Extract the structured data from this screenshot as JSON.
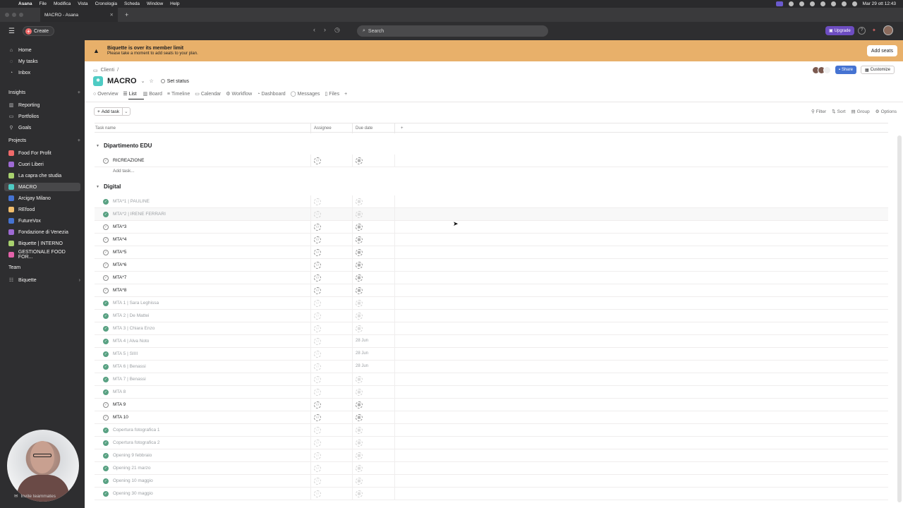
{
  "menubar": {
    "app": "Asana",
    "items": [
      "File",
      "Modifica",
      "Vista",
      "Cronologia",
      "Scheda",
      "Window",
      "Help"
    ],
    "clock": "Mar 29 ott  12:43"
  },
  "browser": {
    "tab_title": "MACRO - Asana"
  },
  "topbar": {
    "create_label": "Create",
    "search_placeholder": "Search",
    "upgrade_label": "Upgrade",
    "help_label": "?"
  },
  "sidebar": {
    "nav": [
      {
        "label": "Home",
        "icon": "home-icon"
      },
      {
        "label": "My tasks",
        "icon": "check-circle-icon"
      },
      {
        "label": "Inbox",
        "icon": "bell-icon"
      }
    ],
    "insights_header": "Insights",
    "insights": [
      {
        "label": "Reporting",
        "icon": "chart-icon"
      },
      {
        "label": "Portfolios",
        "icon": "folder-icon"
      },
      {
        "label": "Goals",
        "icon": "person-icon"
      }
    ],
    "projects_header": "Projects",
    "projects": [
      {
        "label": "Food For Profit",
        "color": "#f06a6a"
      },
      {
        "label": "Cuori Liberi",
        "color": "#9e6ad4"
      },
      {
        "label": "La capra che studia",
        "color": "#a8d16e"
      },
      {
        "label": "MACRO",
        "color": "#4ecbc4"
      },
      {
        "label": "Arcigay Milano",
        "color": "#4573d2"
      },
      {
        "label": "REfood",
        "color": "#f1bd6c"
      },
      {
        "label": "FutureVox",
        "color": "#4573d2"
      },
      {
        "label": "Fondazione di Venezia",
        "color": "#9e6ad4"
      },
      {
        "label": "Biquette | INTERNO",
        "color": "#a8d16e"
      },
      {
        "label": "GESTIONALE FOOD FOR...",
        "color": "#e362a9"
      }
    ],
    "team_header": "Team",
    "team": [
      {
        "label": "Biquette"
      }
    ],
    "footer": "Invite teammates"
  },
  "banner": {
    "title": "Biquette is over its member limit",
    "subtitle": "Please take a moment to add seats to your plan.",
    "button": "Add seats"
  },
  "project": {
    "breadcrumb": "Clienti",
    "name": "MACRO",
    "set_status": "Set status",
    "share": "Share",
    "customize": "Customize",
    "views": [
      "Overview",
      "List",
      "Board",
      "Timeline",
      "Calendar",
      "Workflow",
      "Dashboard",
      "Messages",
      "Files"
    ]
  },
  "toolbar": {
    "add_task": "Add task",
    "filter": "Filter",
    "sort": "Sort",
    "group": "Group",
    "options": "Options"
  },
  "columns": {
    "task_name": "Task name",
    "assignee": "Assignee",
    "due_date": "Due date"
  },
  "sections": [
    {
      "name": "Dipartimento EDU",
      "tasks": [
        {
          "name": "RICREAZIONE",
          "done": false,
          "due": ""
        }
      ],
      "add_task": "Add task..."
    },
    {
      "name": "Digital",
      "tasks": [
        {
          "name": "MTA*1 | PAULINE",
          "done": true,
          "due": ""
        },
        {
          "name": "MTA*2 | IRENE FERRARI",
          "done": true,
          "due": ""
        },
        {
          "name": "MTA*3",
          "done": false,
          "due": ""
        },
        {
          "name": "MTA*4",
          "done": false,
          "due": ""
        },
        {
          "name": "MTA*5",
          "done": false,
          "due": ""
        },
        {
          "name": "MTA*6",
          "done": false,
          "due": ""
        },
        {
          "name": "MTA*7",
          "done": false,
          "due": ""
        },
        {
          "name": "MTA*8",
          "done": false,
          "due": ""
        },
        {
          "name": "MTA 1 | Sara Leghissa",
          "done": true,
          "due": ""
        },
        {
          "name": "MTA 2 | De Mattei",
          "done": true,
          "due": ""
        },
        {
          "name": "MTA 3 | Chiara Enzo",
          "done": true,
          "due": ""
        },
        {
          "name": "MTA 4 | Alva Noto",
          "done": true,
          "due": "28 Jun"
        },
        {
          "name": "MTA 5 | SIIII",
          "done": true,
          "due": "28 Jun"
        },
        {
          "name": "MTA 6 | Benassi",
          "done": true,
          "due": "28 Jun"
        },
        {
          "name": "MTA 7 | Benassi",
          "done": true,
          "due": ""
        },
        {
          "name": "MTA 8",
          "done": true,
          "due": ""
        },
        {
          "name": "MTA 9",
          "done": false,
          "due": ""
        },
        {
          "name": "MTA 10",
          "done": false,
          "due": ""
        },
        {
          "name": "Copertura fotografica 1",
          "done": true,
          "due": ""
        },
        {
          "name": "Copertura fotografica 2",
          "done": true,
          "due": ""
        },
        {
          "name": "Opening 9 febbraio",
          "done": true,
          "due": ""
        },
        {
          "name": "Opening 21 marzo",
          "done": true,
          "due": ""
        },
        {
          "name": "Opening 10 maggio",
          "done": true,
          "due": ""
        },
        {
          "name": "Opening 30 maggio",
          "done": true,
          "due": ""
        }
      ]
    }
  ]
}
